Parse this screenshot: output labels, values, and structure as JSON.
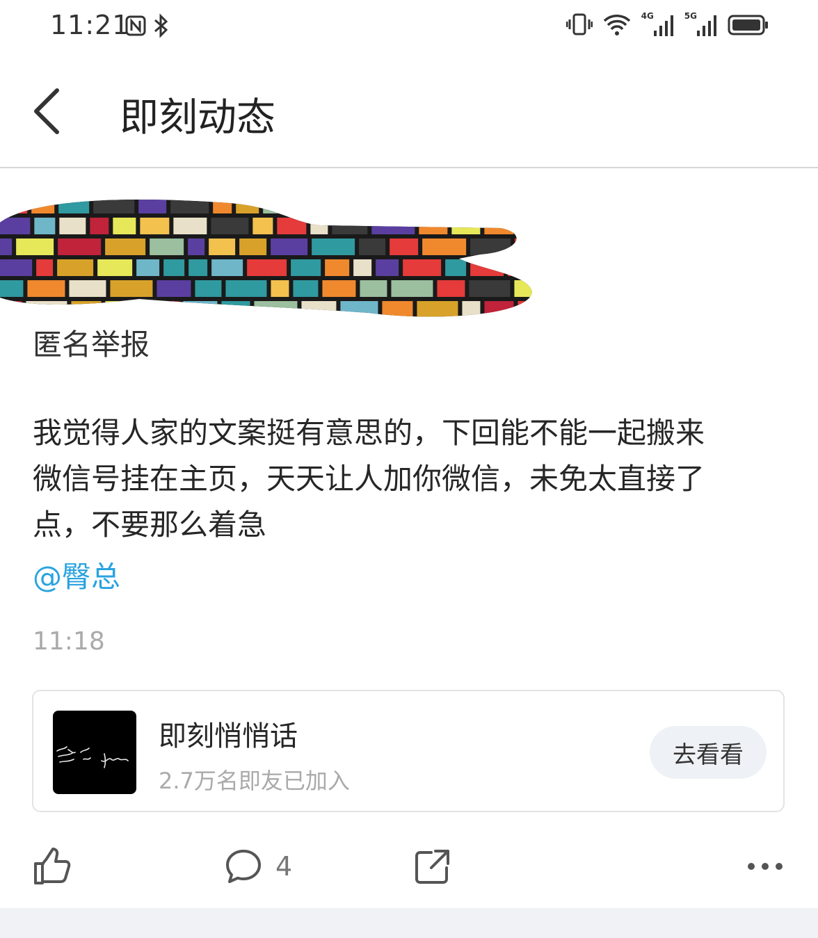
{
  "status_bar": {
    "time": "11:21",
    "net_4g": "4G",
    "net_5g": "5G",
    "icons": [
      "nfc-icon",
      "bluetooth-icon",
      "vibrate-icon",
      "wifi-icon",
      "signal-4g-icon",
      "signal-5g-icon",
      "battery-icon"
    ]
  },
  "header": {
    "title": "即刻动态",
    "back_icon": "chevron-left-icon"
  },
  "post": {
    "anon_label": "匿名举报",
    "text_lines": [
      "我觉得人家的文案挺有意思的，下回能不能一起搬来",
      "微信号挂在主页，天天让人加你微信，未免太直接了",
      "点，不要那么着急"
    ],
    "mention": "@臀总",
    "time": "11:18"
  },
  "topic_card": {
    "name": "即刻悄悄话",
    "members": "2.7万名即友已加入",
    "button_label": "去看看"
  },
  "actions": {
    "comment_count": "4",
    "icons": [
      "like-icon",
      "comment-icon",
      "share-icon",
      "more-icon"
    ]
  },
  "colors": {
    "mention": "#2aa3e0",
    "muted": "#aaaaaa",
    "divider": "#d7d7d7"
  }
}
